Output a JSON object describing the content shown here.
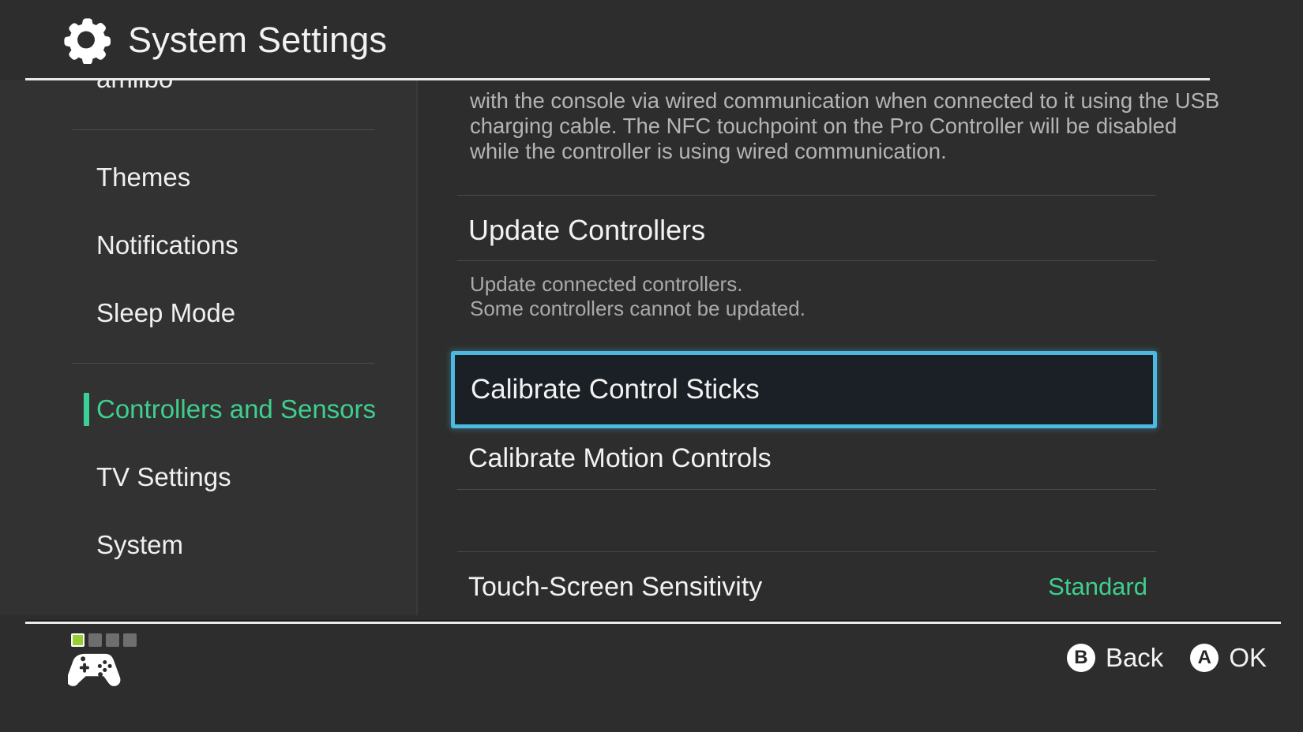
{
  "header": {
    "icon": "gear-icon",
    "title": "System Settings"
  },
  "sidebar": {
    "items": [
      {
        "label": "amiibo",
        "active": false,
        "clipped": true
      },
      {
        "label": "Themes",
        "active": false,
        "clipped": false
      },
      {
        "label": "Notifications",
        "active": false,
        "clipped": false
      },
      {
        "label": "Sleep Mode",
        "active": false,
        "clipped": false
      },
      {
        "label": "Controllers and Sensors",
        "active": true,
        "clipped": false
      },
      {
        "label": "TV Settings",
        "active": false,
        "clipped": false
      },
      {
        "label": "System",
        "active": false,
        "clipped": false
      }
    ]
  },
  "main": {
    "description": {
      "line1": "with the console via wired communication when connected to it using the USB",
      "line2": "charging cable. The NFC touchpoint on the Pro Controller will be disabled",
      "line3": "while the controller is using wired communication."
    },
    "update_controllers": {
      "heading": "Update Controllers",
      "sub_line1": "Update connected controllers.",
      "sub_line2": "Some controllers cannot be updated."
    },
    "calibrate_sticks": {
      "label": "Calibrate Control Sticks",
      "selected": true
    },
    "calibrate_motion": {
      "label": "Calibrate Motion Controls"
    },
    "touch_screen_sensitivity": {
      "label": "Touch-Screen Sensitivity",
      "value": "Standard"
    }
  },
  "footer": {
    "player_indicator": {
      "icon": "controller-icon",
      "slots": [
        "on",
        "off",
        "off",
        "off"
      ]
    },
    "actions": [
      {
        "glyph": "B",
        "label": "Back"
      },
      {
        "glyph": "A",
        "label": "OK"
      }
    ]
  },
  "colors": {
    "accent_green": "#3ecf8e",
    "focus_cyan": "#4cb9e0",
    "player_lime": "#9acd32",
    "background": "#2d2d2d",
    "sidebar_background": "#323232"
  }
}
